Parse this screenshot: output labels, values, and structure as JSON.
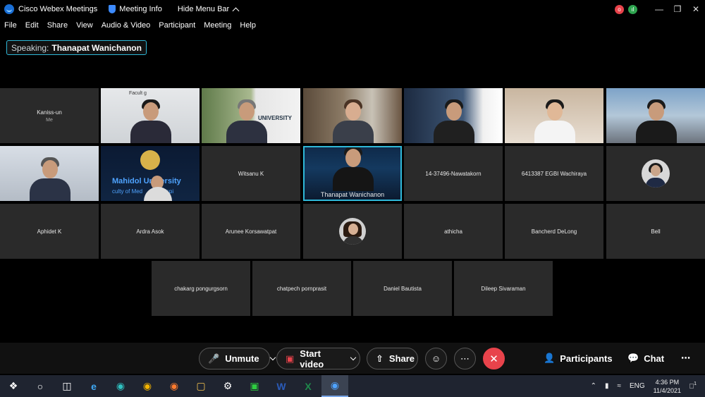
{
  "titlebar": {
    "app_name": "Cisco Webex Meetings",
    "meeting_info": "Meeting Info",
    "hide_menu": "Hide Menu Bar"
  },
  "menu": [
    "File",
    "Edit",
    "Share",
    "View",
    "Audio & Video",
    "Participant",
    "Meeting",
    "Help"
  ],
  "speaking": {
    "label": "Speaking:",
    "name": "Thanapat Wanichanon"
  },
  "tiles": {
    "r1c1": {
      "name": "Kaniss-un",
      "sub": "Me"
    },
    "r2c3": {
      "name": "Witsanu K"
    },
    "r2c4": {
      "caption": "Thanapat Wanichanon"
    },
    "r2c5": {
      "name": "14-37496-Nawatakorn"
    },
    "r2c6": {
      "name": "6413387 EGBI Wachiraya"
    },
    "r3c1": {
      "name": "Aphidet K"
    },
    "r3c2": {
      "name": "Ardra Asok"
    },
    "r3c3": {
      "name": "Arunee Korsawatpat"
    },
    "r3c5": {
      "name": "athicha"
    },
    "r3c6": {
      "name": "Bancherd DeLong"
    },
    "r3c7": {
      "name": "Bell"
    },
    "r4c1": {
      "name": "chakarg pongurgsorn"
    },
    "r4c2": {
      "name": "chatpech pornprasit"
    },
    "r4c3": {
      "name": "Daniel Bautista"
    },
    "r4c4": {
      "name": "Dileep Sivaraman"
    }
  },
  "video_text": {
    "mahidol": "Mahidol University",
    "mahidol_sub": "culty of Med      ali Hospi",
    "faculty": "Facult      g",
    "univ": "UNIVERSITY"
  },
  "controls": {
    "unmute": "Unmute",
    "start_video": "Start video",
    "share": "Share",
    "participants": "Participants",
    "chat": "Chat"
  },
  "taskbar": {
    "lang": "ENG",
    "time": "4:36 PM",
    "date": "11/4/2021",
    "notif_count": "1"
  },
  "colors": {
    "accent": "#2fb8d8",
    "end_red": "#e8434b",
    "tile_bg": "#2a2a2a"
  }
}
